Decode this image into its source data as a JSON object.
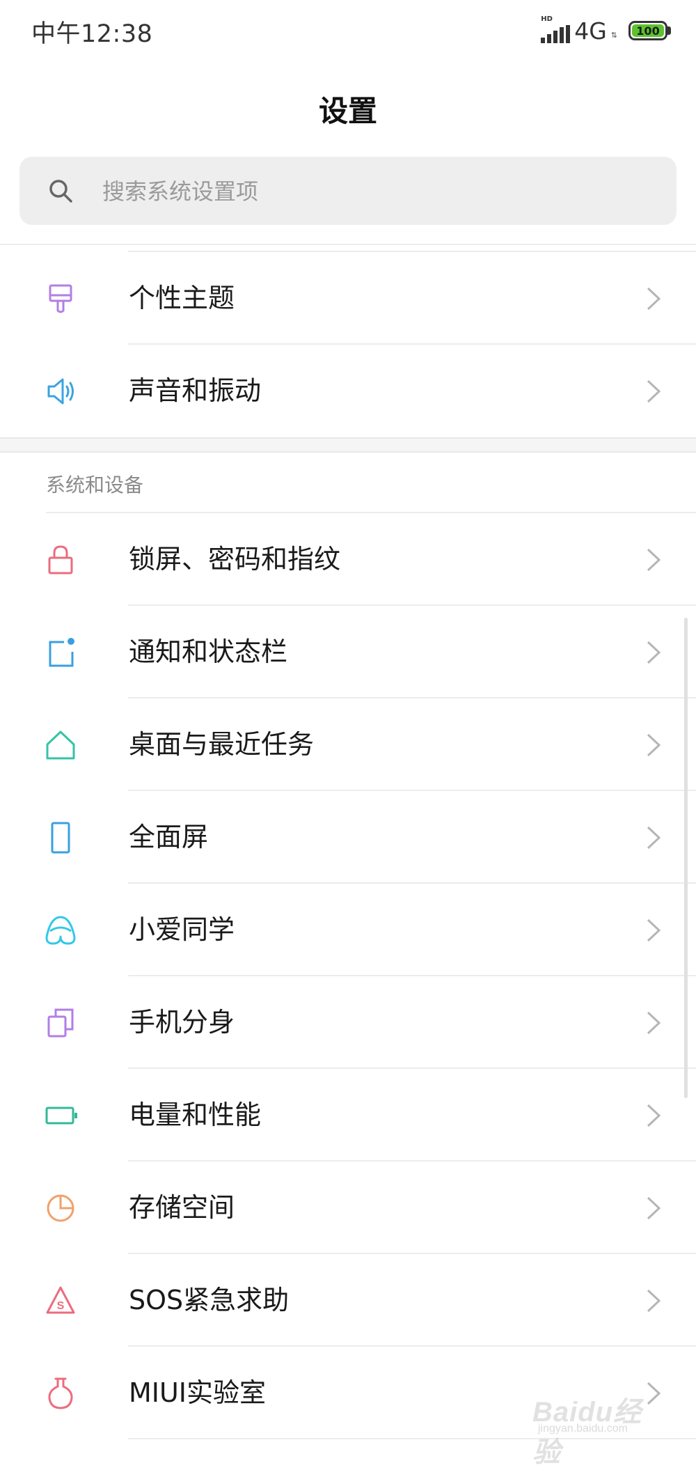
{
  "status_bar": {
    "time": "中午12:38",
    "hd_label": "HD",
    "network": "4G",
    "battery": "100"
  },
  "header": {
    "title": "设置"
  },
  "search": {
    "placeholder": "搜索系统设置项"
  },
  "section_personal": {
    "items": [
      {
        "label": "个性主题",
        "icon": "theme-brush-icon",
        "color": "#b27ee6"
      },
      {
        "label": "声音和振动",
        "icon": "speaker-icon",
        "color": "#3aa3e0"
      }
    ]
  },
  "section_system": {
    "header": "系统和设备",
    "items": [
      {
        "label": "锁屏、密码和指纹",
        "icon": "lock-icon",
        "color": "#ec6c7e"
      },
      {
        "label": "通知和状态栏",
        "icon": "notification-icon",
        "color": "#3a9fe0"
      },
      {
        "label": "桌面与最近任务",
        "icon": "home-icon",
        "color": "#33c4a6"
      },
      {
        "label": "全面屏",
        "icon": "phone-screen-icon",
        "color": "#3a9fe0"
      },
      {
        "label": "小爱同学",
        "icon": "xiaoai-icon",
        "color": "#31c9e6"
      },
      {
        "label": "手机分身",
        "icon": "dual-space-icon",
        "color": "#b27ee6"
      },
      {
        "label": "电量和性能",
        "icon": "battery-icon",
        "color": "#33b89a"
      },
      {
        "label": "存储空间",
        "icon": "storage-pie-icon",
        "color": "#f2a06b"
      },
      {
        "label": "SOS紧急求助",
        "icon": "sos-icon",
        "color": "#ec6c7e"
      },
      {
        "label": "MIUI实验室",
        "icon": "lab-flask-icon",
        "color": "#ec6c7e"
      }
    ]
  },
  "watermark": {
    "text": "Baidu经验",
    "sub": "jingyan.baidu.com"
  }
}
